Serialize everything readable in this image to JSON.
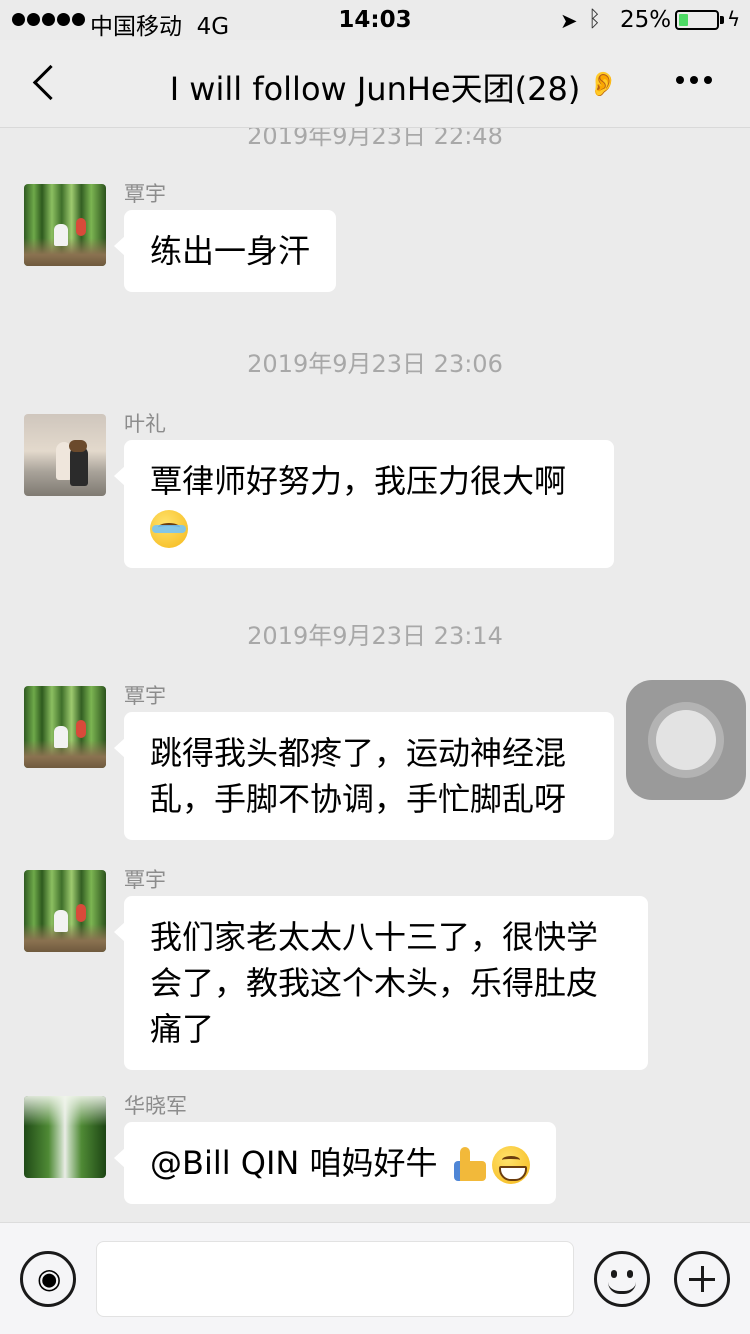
{
  "status_bar": {
    "carrier": "中国移动",
    "network": "4G",
    "time": "14:03",
    "battery_percent": "25%",
    "battery_level": 0.25,
    "battery_color": "#4cd964"
  },
  "nav": {
    "title": "I will follow JunHe天团(28)",
    "back_icon": "chevron-left-icon",
    "mute_icon": "ear-muted-icon",
    "more_icon": "more-dots-icon"
  },
  "messages": {
    "ts0": "2019年9月23日 22:48",
    "m1": {
      "sender": "覃宇",
      "text": "练出一身汗"
    },
    "ts1": "2019年9月23日 23:06",
    "m2": {
      "sender": "叶礼",
      "text": "覃律师好努力，我压力很大啊"
    },
    "ts2": "2019年9月23日 23:14",
    "m3": {
      "sender": "覃宇",
      "line1": "跳得我头都疼了，运动神经混",
      "line2": "乱，手脚不协调，手忙脚乱呀"
    },
    "m4": {
      "sender": "覃宇",
      "line1": "我们家老太太八十三了，很快学",
      "line2": "会了，教我这个木头，乐得肚皮",
      "line3": "痛了"
    },
    "m5": {
      "sender": "华晓军",
      "text": "@Bill QIN 咱妈好牛"
    }
  },
  "input_bar": {
    "voice_icon": "voice-icon",
    "emoji_icon": "emoji-icon",
    "plus_icon": "plus-icon"
  }
}
